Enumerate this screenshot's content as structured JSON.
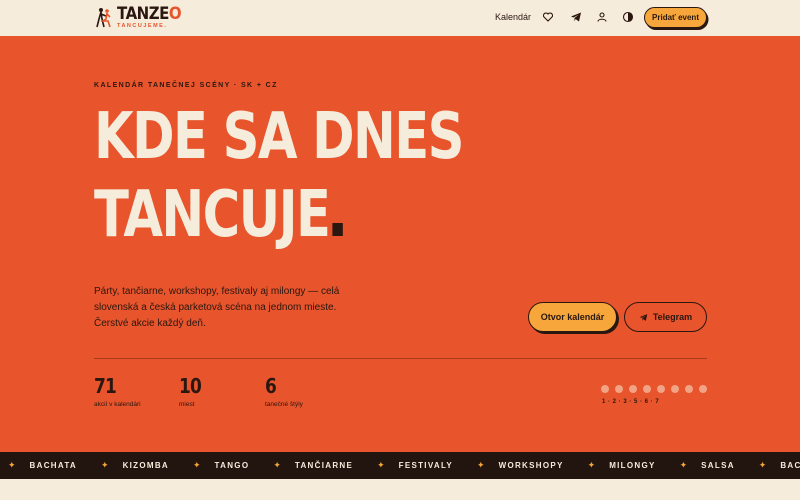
{
  "brand": {
    "name_main": "TANZE",
    "name_accent": "O",
    "tagline": "TANCUJEME.",
    "accent_color": "#e8542b"
  },
  "nav": {
    "calendar_link": "Kalendár",
    "icons": [
      "heart-icon",
      "telegram-icon",
      "user-icon",
      "theme-toggle-icon"
    ],
    "add_event_label": "Pridať event"
  },
  "hero": {
    "eyebrow": "KALENDÁR TANEČNEJ SCÉNY · SK + CZ",
    "headline_line1": "KDE SA DNES",
    "headline_line2": "TANCUJE",
    "lede": "Párty, tančiarne, workshopy, festivaly aj milongy — celá slovenská a česká parketová scéna na jednom mieste. Čerstvé akcie každý deň.",
    "primary_cta": "Otvor kalendár",
    "secondary_cta": "Telegram",
    "background_color": "#e8542b"
  },
  "stats": [
    {
      "value": "71",
      "label": "akcií v kalendári"
    },
    {
      "value": "10",
      "label": "miest"
    },
    {
      "value": "6",
      "label": "tanečné štýly"
    }
  ],
  "rhythm": {
    "dot_count": 8,
    "caption": "1 · 2 · 3  ·  5 · 6 · 7"
  },
  "ticker": {
    "items": [
      "BACHATA",
      "KIZOMBA",
      "TANGO",
      "TANČIARNE",
      "FESTIVALY",
      "WORKSHOPY",
      "MILONGY",
      "SALSA",
      "BACHATA"
    ]
  }
}
